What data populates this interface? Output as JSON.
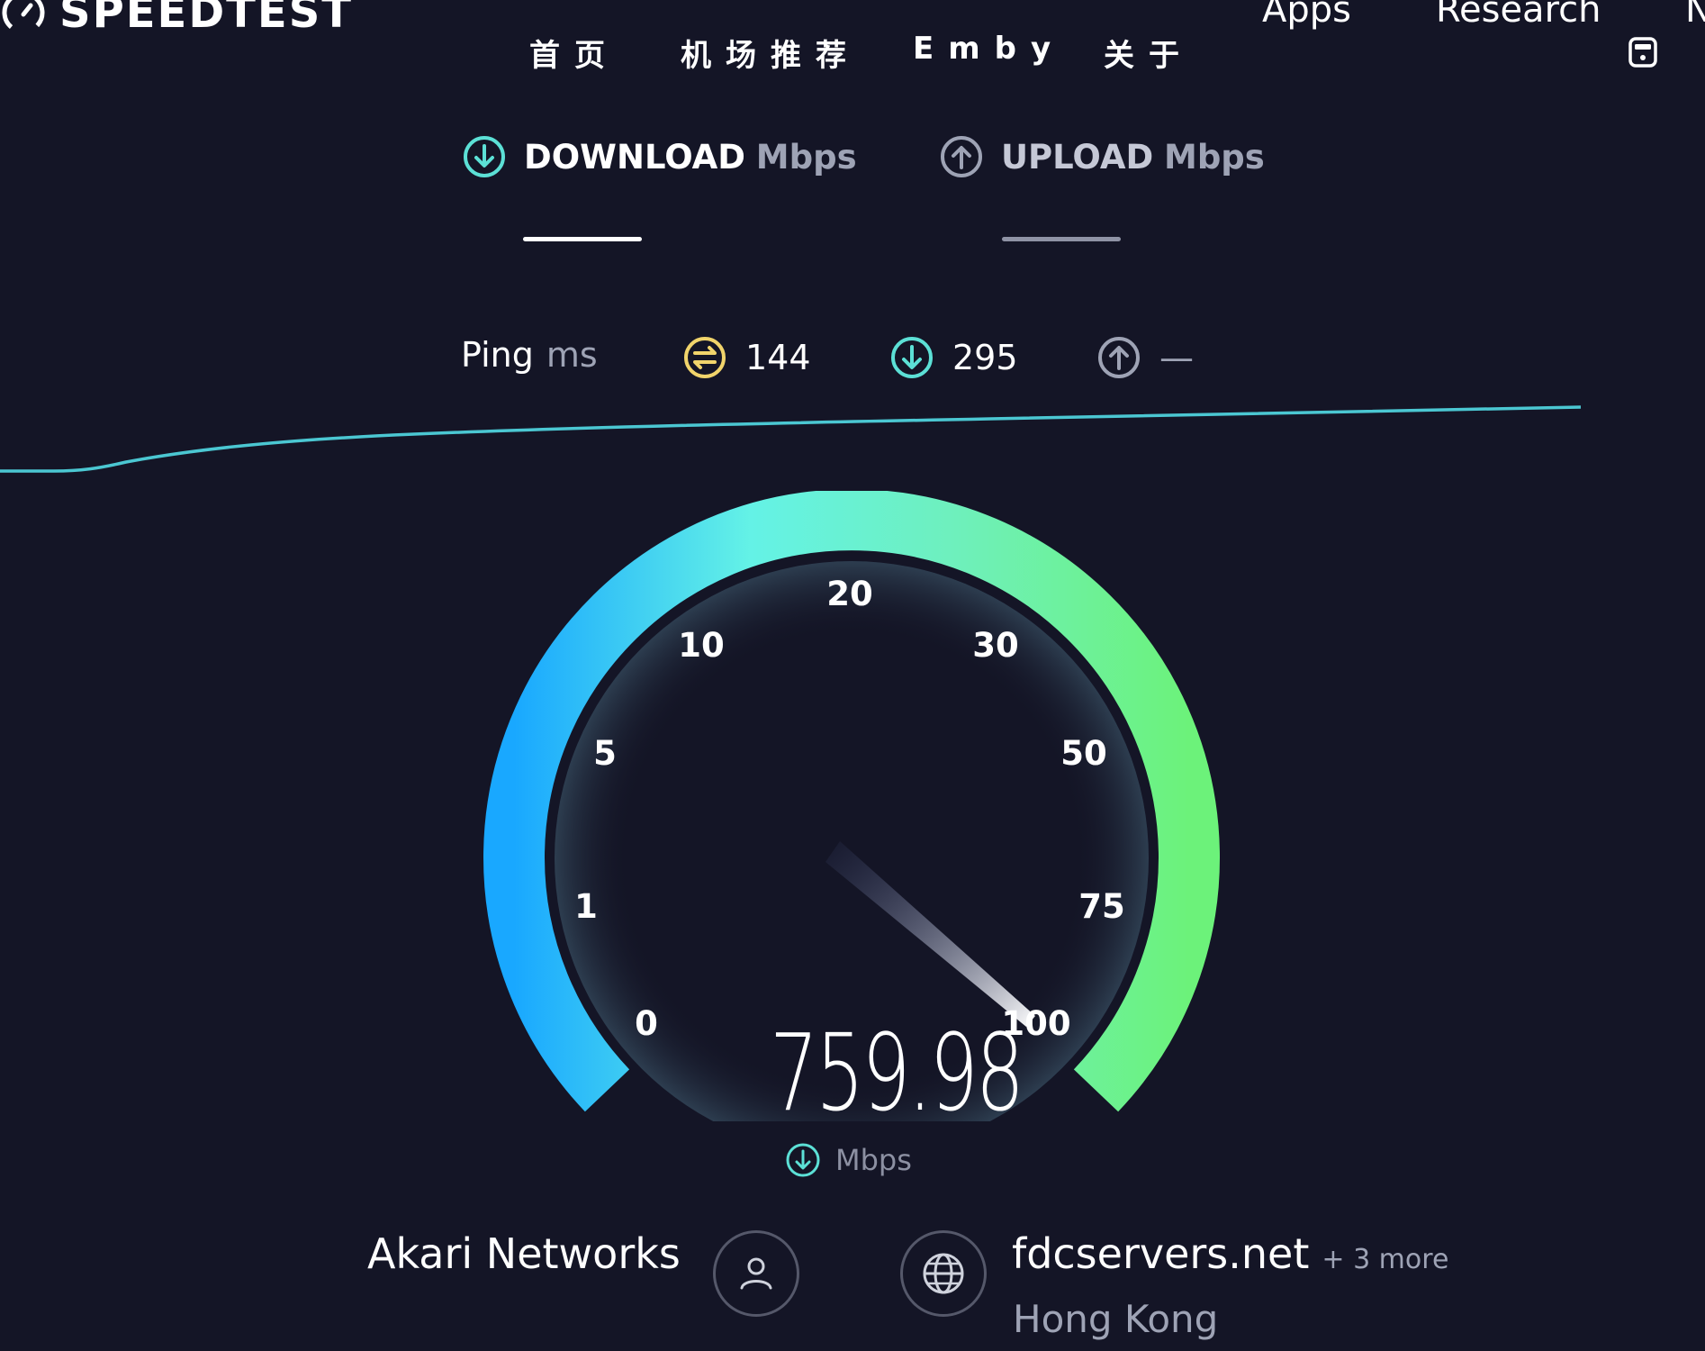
{
  "header": {
    "logo_text": "SPEEDTEST",
    "nav_cn": [
      "首页",
      "机场推荐",
      "Emby",
      "关于"
    ],
    "nav_en": [
      "Apps",
      "Research"
    ],
    "nav_cut": "N"
  },
  "tabs": [
    {
      "label": "DOWNLOAD",
      "unit": "Mbps",
      "active": true
    },
    {
      "label": "UPLOAD",
      "unit": "Mbps",
      "active": false
    }
  ],
  "ping": {
    "label": "Ping",
    "unit": "ms",
    "idle": "144",
    "download": "295",
    "upload": "—"
  },
  "gauge": {
    "ticks": [
      "0",
      "1",
      "5",
      "10",
      "20",
      "30",
      "50",
      "75",
      "100"
    ],
    "speed": "759.98",
    "unit": "Mbps"
  },
  "isp": {
    "name": "Akari Networks"
  },
  "server": {
    "name": "fdcservers.net",
    "more": "+ 3 more",
    "location": "Hong Kong"
  },
  "colors": {
    "background": "#141526",
    "accent_teal": "#5ce0d6",
    "ping_yellow": "#f1d46b",
    "gauge_start": "#19a8ff",
    "gauge_mid": "#64f2e6",
    "gauge_end": "#6cf27a"
  }
}
